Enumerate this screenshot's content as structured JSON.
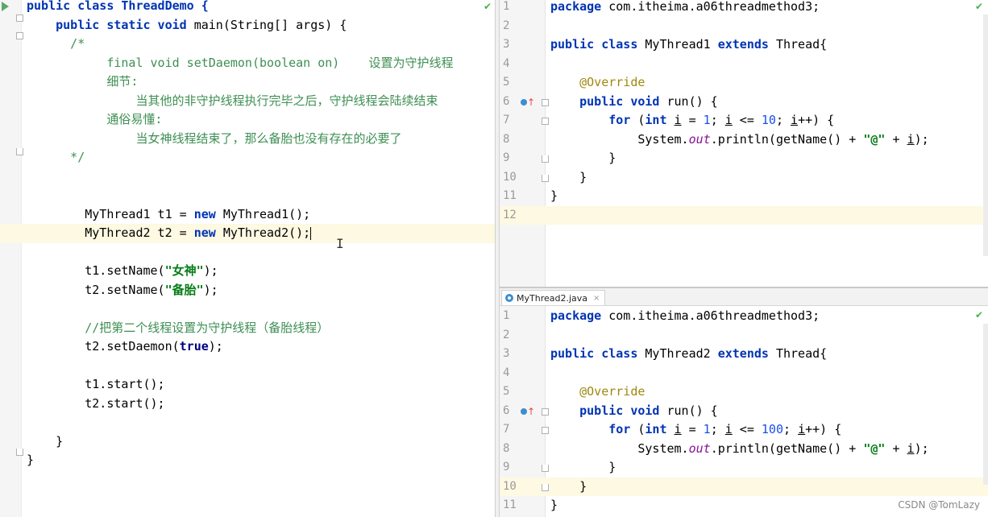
{
  "left_editor": {
    "lines": [
      {
        "frag": [
          {
            "t": "public class ThreadDemo {",
            "c": "kw"
          }
        ]
      },
      {
        "frag": [
          {
            "t": "    "
          },
          {
            "t": "public static void ",
            "c": "kw"
          },
          {
            "t": "main(String[] args) {"
          }
        ]
      },
      {
        "frag": [
          {
            "t": "      /*",
            "c": "doc"
          }
        ]
      },
      {
        "frag": [
          {
            "t": "           final void setDaemon(boolean on)    设置为守护线程",
            "c": "doc"
          }
        ]
      },
      {
        "frag": [
          {
            "t": "           细节:",
            "c": "doc"
          }
        ]
      },
      {
        "frag": [
          {
            "t": "               当其他的非守护线程执行完毕之后，守护线程会陆续结束",
            "c": "doc"
          }
        ]
      },
      {
        "frag": [
          {
            "t": "           通俗易懂:",
            "c": "doc"
          }
        ]
      },
      {
        "frag": [
          {
            "t": "               当女神线程结束了，那么备胎也没有存在的必要了",
            "c": "doc"
          }
        ]
      },
      {
        "frag": [
          {
            "t": "      */",
            "c": "doc"
          }
        ]
      },
      {
        "frag": []
      },
      {
        "frag": []
      },
      {
        "frag": [
          {
            "t": "        MyThread1 t1 = "
          },
          {
            "t": "new ",
            "c": "kw"
          },
          {
            "t": "MyThread1();"
          }
        ]
      },
      {
        "frag": [
          {
            "t": "        MyThread2 t2 = "
          },
          {
            "t": "new ",
            "c": "kw"
          },
          {
            "t": "MyThread2();"
          }
        ],
        "caret": true,
        "hl": true
      },
      {
        "frag": []
      },
      {
        "frag": [
          {
            "t": "        t1.setName("
          },
          {
            "t": "\"女神\"",
            "c": "str"
          },
          {
            "t": ");"
          }
        ]
      },
      {
        "frag": [
          {
            "t": "        t2.setName("
          },
          {
            "t": "\"备胎\"",
            "c": "str"
          },
          {
            "t": ");"
          }
        ]
      },
      {
        "frag": []
      },
      {
        "frag": [
          {
            "t": "        //把第二个线程设置为守护线程（备胎线程）",
            "c": "doc"
          }
        ]
      },
      {
        "frag": [
          {
            "t": "        t2.setDaemon("
          },
          {
            "t": "true",
            "c": "kwn"
          },
          {
            "t": ");"
          }
        ]
      },
      {
        "frag": []
      },
      {
        "frag": [
          {
            "t": "        t1.start();"
          }
        ]
      },
      {
        "frag": [
          {
            "t": "        t2.start();"
          }
        ]
      },
      {
        "frag": []
      },
      {
        "frag": [
          {
            "t": "    }"
          }
        ]
      },
      {
        "frag": [
          {
            "t": "}"
          }
        ]
      }
    ]
  },
  "right_top_editor": {
    "tab_label": "",
    "lines": [
      {
        "n": "1",
        "frag": [
          {
            "t": "package ",
            "c": "kw"
          },
          {
            "t": "com.itheima.a06threadmethod3;"
          }
        ]
      },
      {
        "n": "2",
        "frag": []
      },
      {
        "n": "3",
        "frag": [
          {
            "t": "public class ",
            "c": "kw"
          },
          {
            "t": "MyThread1 "
          },
          {
            "t": "extends ",
            "c": "kw"
          },
          {
            "t": "Thread{"
          }
        ]
      },
      {
        "n": "4",
        "frag": []
      },
      {
        "n": "5",
        "frag": [
          {
            "t": "    @Override",
            "c": "ann"
          }
        ]
      },
      {
        "n": "6",
        "frag": [
          {
            "t": "    "
          },
          {
            "t": "public void ",
            "c": "kw"
          },
          {
            "t": "run() {"
          }
        ]
      },
      {
        "n": "7",
        "frag": [
          {
            "t": "        "
          },
          {
            "t": "for ",
            "c": "kw"
          },
          {
            "t": "("
          },
          {
            "t": "int ",
            "c": "kw"
          },
          {
            "t": "i",
            "c": "ul"
          },
          {
            "t": " = "
          },
          {
            "t": "1",
            "c": "num"
          },
          {
            "t": "; "
          },
          {
            "t": "i",
            "c": "ul"
          },
          {
            "t": " <= "
          },
          {
            "t": "10",
            "c": "num"
          },
          {
            "t": "; "
          },
          {
            "t": "i",
            "c": "ul"
          },
          {
            "t": "++) {"
          }
        ]
      },
      {
        "n": "8",
        "frag": [
          {
            "t": "            System."
          },
          {
            "t": "out",
            "c": "field"
          },
          {
            "t": ".println(getName() + "
          },
          {
            "t": "\"@\"",
            "c": "str"
          },
          {
            "t": " + "
          },
          {
            "t": "i",
            "c": "ul"
          },
          {
            "t": ");"
          }
        ]
      },
      {
        "n": "9",
        "frag": [
          {
            "t": "        }"
          }
        ]
      },
      {
        "n": "10",
        "frag": [
          {
            "t": "    }"
          }
        ]
      },
      {
        "n": "11",
        "frag": [
          {
            "t": "}"
          }
        ]
      },
      {
        "n": "12",
        "frag": [],
        "hl": true
      }
    ]
  },
  "right_bottom_editor": {
    "tab_label": "MyThread2.java",
    "tab_close": "×",
    "lines": [
      {
        "n": "1",
        "frag": [
          {
            "t": "package ",
            "c": "kw"
          },
          {
            "t": "com.itheima.a06threadmethod3;"
          }
        ]
      },
      {
        "n": "2",
        "frag": []
      },
      {
        "n": "3",
        "frag": [
          {
            "t": "public class ",
            "c": "kw"
          },
          {
            "t": "MyThread2 "
          },
          {
            "t": "extends ",
            "c": "kw"
          },
          {
            "t": "Thread{"
          }
        ]
      },
      {
        "n": "4",
        "frag": []
      },
      {
        "n": "5",
        "frag": [
          {
            "t": "    @Override",
            "c": "ann"
          }
        ]
      },
      {
        "n": "6",
        "frag": [
          {
            "t": "    "
          },
          {
            "t": "public void ",
            "c": "kw"
          },
          {
            "t": "run() {"
          }
        ]
      },
      {
        "n": "7",
        "frag": [
          {
            "t": "        "
          },
          {
            "t": "for ",
            "c": "kw"
          },
          {
            "t": "("
          },
          {
            "t": "int ",
            "c": "kw"
          },
          {
            "t": "i",
            "c": "ul"
          },
          {
            "t": " = "
          },
          {
            "t": "1",
            "c": "num"
          },
          {
            "t": "; "
          },
          {
            "t": "i",
            "c": "ul"
          },
          {
            "t": " <= "
          },
          {
            "t": "100",
            "c": "num"
          },
          {
            "t": "; "
          },
          {
            "t": "i",
            "c": "ul"
          },
          {
            "t": "++) {"
          }
        ]
      },
      {
        "n": "8",
        "frag": [
          {
            "t": "            System."
          },
          {
            "t": "out",
            "c": "field"
          },
          {
            "t": ".println(getName() + "
          },
          {
            "t": "\"@\"",
            "c": "str"
          },
          {
            "t": " + "
          },
          {
            "t": "i",
            "c": "ul"
          },
          {
            "t": ");"
          }
        ]
      },
      {
        "n": "9",
        "frag": [
          {
            "t": "        }"
          }
        ]
      },
      {
        "n": "10",
        "frag": [
          {
            "t": "    }"
          }
        ],
        "hl": true
      },
      {
        "n": "11",
        "frag": [
          {
            "t": "}"
          }
        ]
      }
    ]
  },
  "inspection_icon": "check-icon",
  "inspection_glyph": "✔",
  "watermark": "CSDN @TomLazy",
  "colors": {
    "keyword": "#0033b3",
    "string": "#067d17",
    "number": "#1750eb",
    "doc_comment": "#3e8f53",
    "annotation": "#9e880d",
    "current_line": "#fdf9e2"
  }
}
